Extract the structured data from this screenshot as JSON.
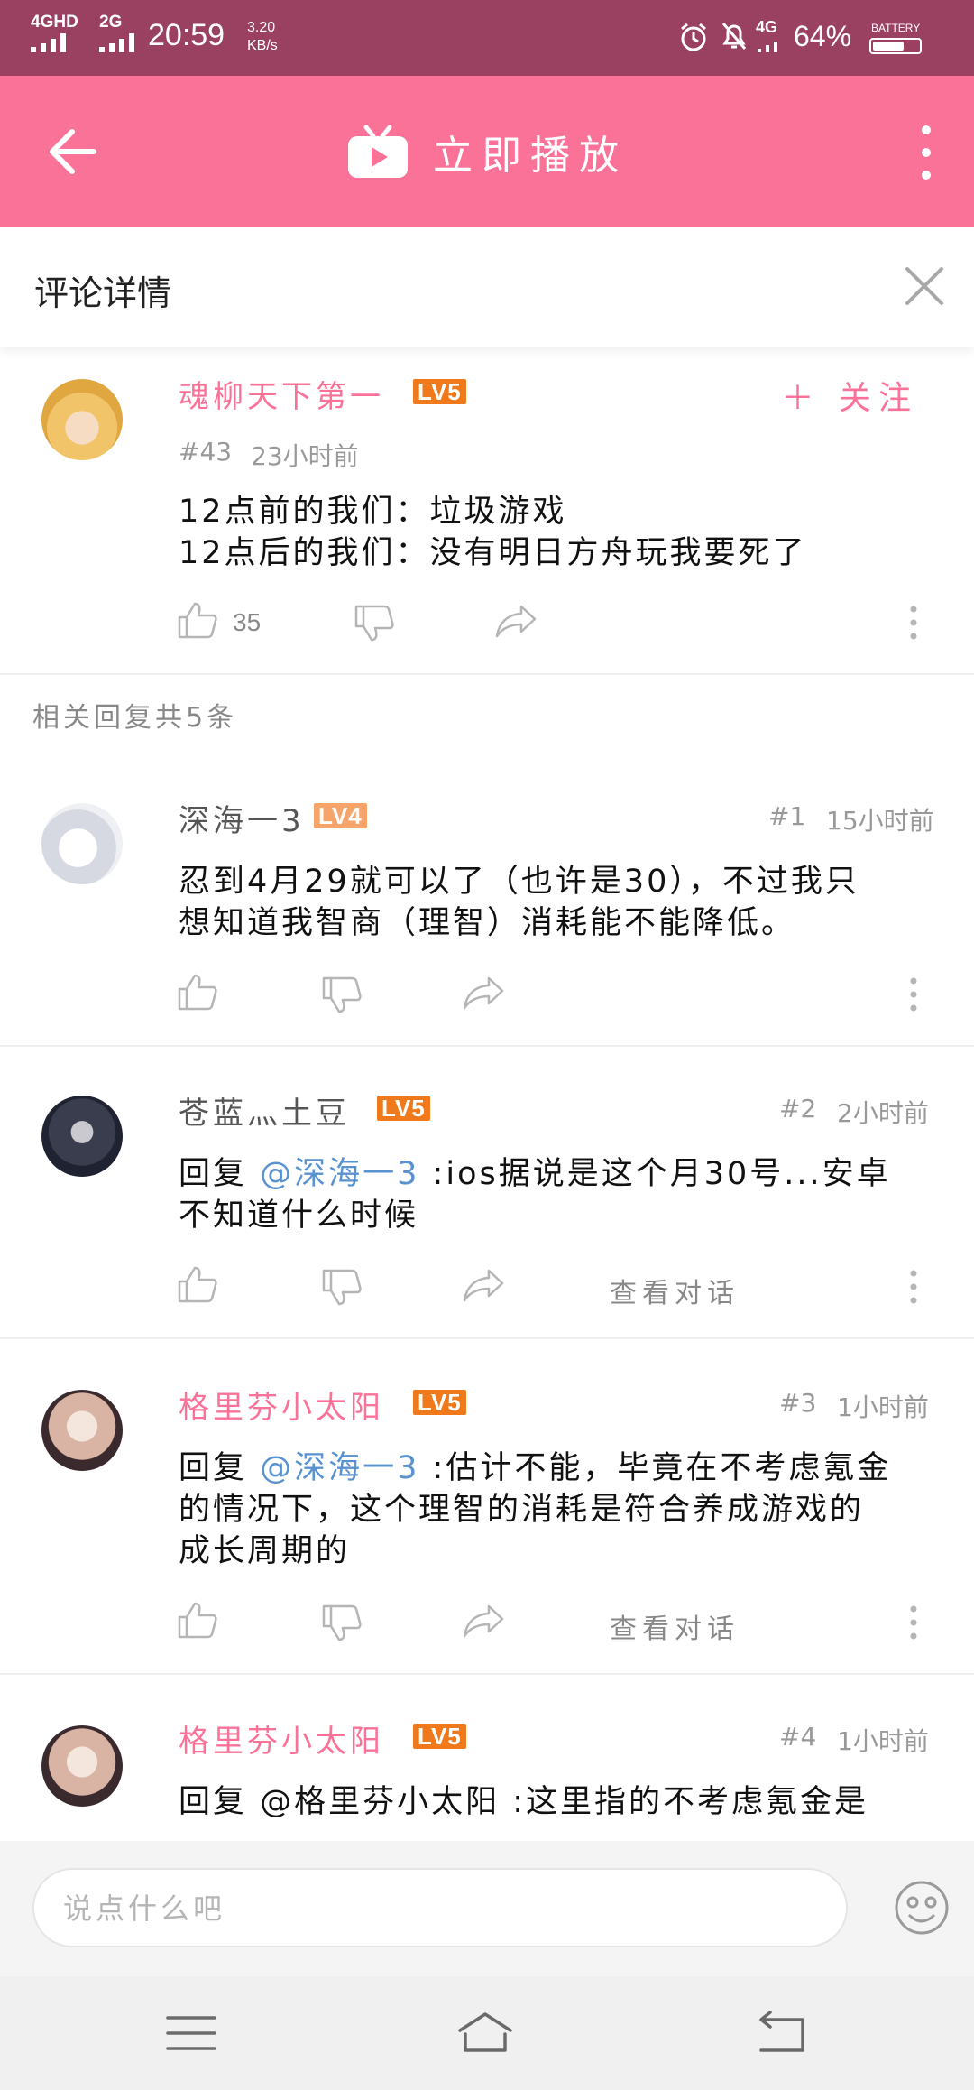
{
  "status_bar": {
    "network1": "4GHD",
    "network2": "2G",
    "time": "20:59",
    "speed_value": "3.20",
    "speed_unit": "KB/s",
    "network3": "4G",
    "battery_percent": "64%",
    "battery_label": "BATTERY"
  },
  "app_bar": {
    "title": "立即播放"
  },
  "section": {
    "title": "评论详情"
  },
  "main_comment": {
    "username": "魂柳天下第一",
    "level": "LV5",
    "follow_label": "＋ 关注",
    "floor": "#43",
    "time": "23小时前",
    "lines": [
      "12点前的我们：垃圾游戏",
      "12点后的我们：没有明日方舟玩我要死了"
    ],
    "likes": "35"
  },
  "replies_header": "相关回复共5条",
  "replies": [
    {
      "username": "深海一3",
      "level": "LV4",
      "floor": "#1",
      "time": "15小时前",
      "lines": [
        "忍到4月29就可以了（也许是30），不过我只",
        "想知道我智商（理智）消耗能不能降低。"
      ]
    },
    {
      "username": "苍蓝灬土豆",
      "level": "LV5",
      "floor": "#2",
      "time": "2小时前",
      "reply_prefix": "回复 ",
      "mention": "@深海一3",
      "lines": [
        " :ios据说是这个月30号...安卓",
        "不知道什么时候"
      ],
      "view_conversation": "查看对话"
    },
    {
      "username": "格里芬小太阳",
      "level": "LV5",
      "floor": "#3",
      "time": "1小时前",
      "reply_prefix": "回复 ",
      "mention": "@深海一3",
      "lines": [
        " :估计不能，毕竟在不考虑氪金",
        "的情况下，这个理智的消耗是符合养成游戏的",
        "成长周期的"
      ],
      "view_conversation": "查看对话"
    },
    {
      "username": "格里芬小太阳",
      "level": "LV5",
      "floor": "#4",
      "time": "1小时前",
      "lines": [
        "回复 @格里芬小太阳 :这里指的不考虑氪金是"
      ]
    }
  ],
  "input": {
    "placeholder": "说点什么吧"
  },
  "colors": {
    "accent": "#fb7299",
    "status_bar": "#9a4060",
    "mention": "#5a92d0"
  },
  "icons": [
    "back-arrow-icon",
    "tv-logo-icon",
    "more-vertical-icon",
    "close-icon",
    "thumbs-up-icon",
    "thumbs-down-icon",
    "share-icon",
    "emoji-icon",
    "menu-icon",
    "home-icon",
    "back-icon"
  ]
}
